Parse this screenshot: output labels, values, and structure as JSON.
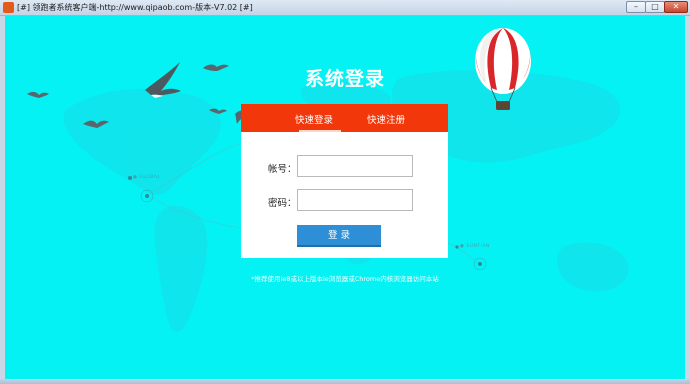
{
  "window": {
    "title": "[#] 领跑者系统客户端-http://www.qipaob.com-版本-V7.02 [#]",
    "min_glyph": "–",
    "max_glyph": "□",
    "close_glyph": "✕"
  },
  "login": {
    "page_title": "系统登录",
    "tabs": [
      {
        "label": "快速登录",
        "active": true
      },
      {
        "label": "快速注册",
        "active": false
      }
    ],
    "account_label": "帐号：",
    "password_label": "密码：",
    "account_value": "",
    "password_value": "",
    "submit_label": "登 录",
    "tip": "*推荐使用ie8或以上版本ie浏览器或Chrome内核浏览器访问本站"
  },
  "colors": {
    "background": "#04f2f4",
    "tab_bar": "#f2380b",
    "button": "#2e8fd6"
  },
  "icons": [
    "app-icon",
    "hot-air-balloon-icon",
    "seagull-icon"
  ]
}
